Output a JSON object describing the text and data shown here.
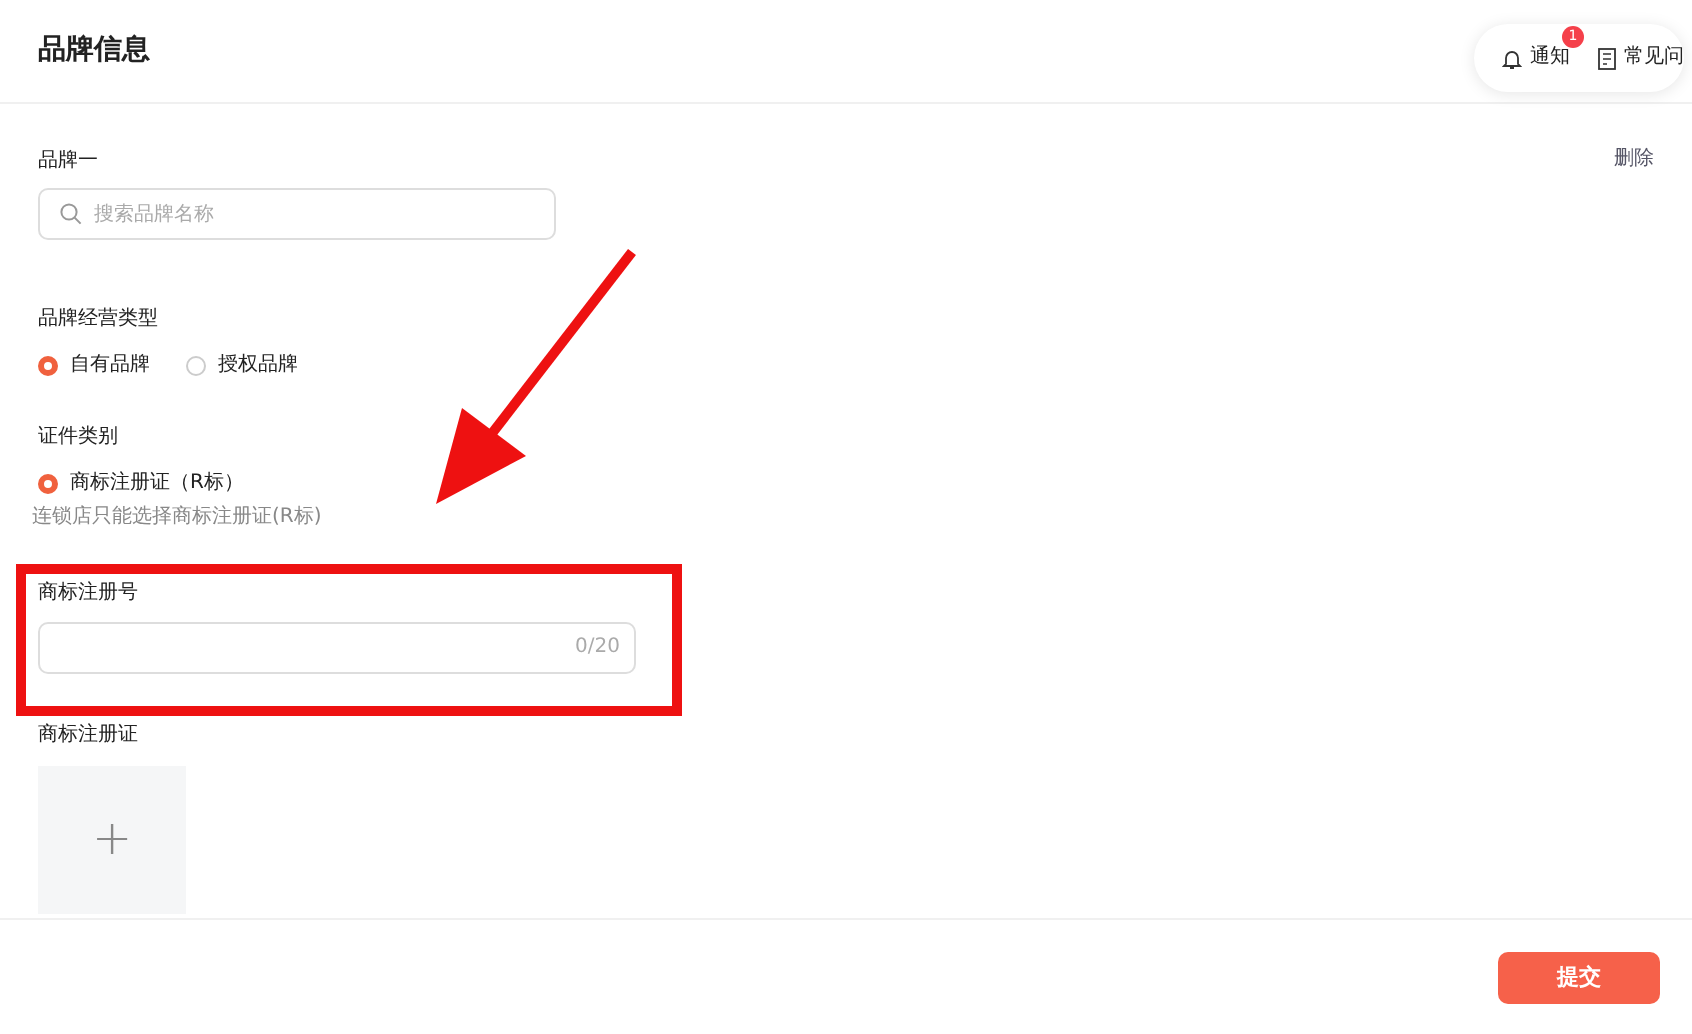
{
  "title": "品牌信息",
  "top_actions": [
    {
      "kind": "bell",
      "label": "通知",
      "badge": "1"
    },
    {
      "kind": "doc",
      "label": "常见问"
    }
  ],
  "brand": {
    "label": "品牌一",
    "delete": "删除",
    "search": {
      "placeholder": "搜索品牌名称"
    }
  },
  "operation_type": {
    "label": "品牌经营类型",
    "options": [
      {
        "label": "自有品牌",
        "selected": true
      },
      {
        "label": "授权品牌",
        "selected": false
      }
    ]
  },
  "certificate_type": {
    "label": "证件类别",
    "options": [
      {
        "label": "商标注册证（R标）",
        "selected": true
      }
    ],
    "hint": "连锁店只能选择商标注册证(R标)"
  },
  "registration_number": {
    "label": "商标注册号",
    "counter": "0/20"
  },
  "certificate": {
    "label": "商标注册证",
    "upload": "+"
  },
  "submit": "提交",
  "arrow_annotation": true,
  "highlight_annotation": true
}
